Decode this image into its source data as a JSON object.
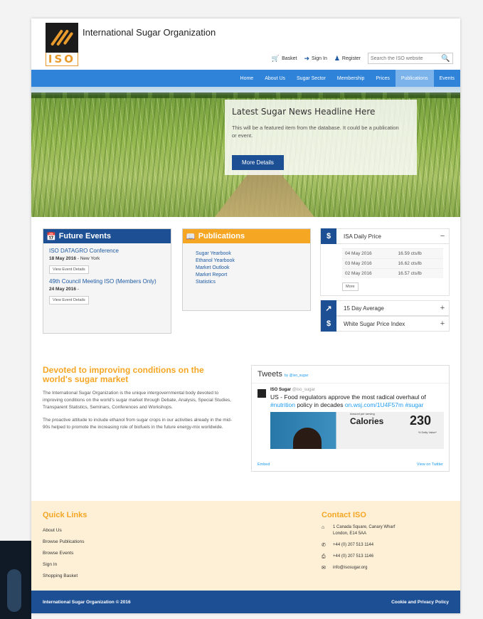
{
  "header": {
    "org_name": "International Sugar Organization",
    "logo_text": "ISO",
    "basket": "Basket",
    "sign_in": "Sign In",
    "register": "Register",
    "search_placeholder": "Search the ISO website"
  },
  "nav": {
    "items": [
      "Home",
      "About Us",
      "Sugar Sector",
      "Membership",
      "Prices",
      "Publications",
      "Events"
    ],
    "active": "Publications"
  },
  "hero": {
    "title": "Latest Sugar News Headline Here",
    "text": "This will be a featured item from the database. It could be a publication or event.",
    "button": "More Details"
  },
  "events": {
    "title": "Future Events",
    "items": [
      {
        "title": "ISO DATAGRO Conference",
        "date": "18 May 2016",
        "location": " - New York",
        "button": "View Event Details"
      },
      {
        "title": "49th Council Meeting ISO (Members Only)",
        "date": "24 May 2016",
        "location": " -",
        "button": "View Event Details"
      }
    ]
  },
  "publications": {
    "title": "Publications",
    "items": [
      "Sugar Yearbook",
      "Ethanol Yearbook",
      "Market Outlook",
      "Market Report",
      "Statistics"
    ]
  },
  "prices": {
    "isa": {
      "label": "ISA Daily Price",
      "toggle": "−"
    },
    "rows": [
      {
        "date": "04 May 2016",
        "value": "16.59 cts/lb"
      },
      {
        "date": "03 May 2016",
        "value": "16.62 cts/lb"
      },
      {
        "date": "02 May 2016",
        "value": "16.57 cts/lb"
      }
    ],
    "more": "More",
    "avg": {
      "label": "15 Day Average",
      "toggle": "+"
    },
    "white": {
      "label": "White Sugar Price Index",
      "toggle": "+"
    },
    "dollar_symbol": "$"
  },
  "about": {
    "heading": "Devoted to improving conditions on the world's sugar market",
    "para1": "The International Sugar Organization is the unique intergovernmental body devoted to improving conditions on the world's sugar market through Debate, Analysis, Special Studies, Transparent Statistics, Seminars, Conferences and Workshops.",
    "para2": "The proactive attitude to include ethanol from sugar crops in our activities already in the mid-90s helped to promote the increasing role of biofuels in the future energy-mix worldwide."
  },
  "tweets": {
    "title": "Tweets",
    "by": "by @iso_sugar",
    "user": "ISO Sugar",
    "handle": "@iso_sugar",
    "text_pre": "US - Food regulators approve the most radical overhaul of ",
    "hashtag1": "#nutrition",
    "text_mid": " policy in decades ",
    "link": "on.wsj.com/1U4F57m",
    "hashtag2": " #sugar",
    "img_calories": "Calories",
    "img_number": "230",
    "img_serving": "Amount per serving",
    "img_dv": "% Daily Value*",
    "embed": "Embed",
    "view": "View on Twitter"
  },
  "footer": {
    "quick_links_title": "Quick Links",
    "quick_links": [
      "About Us",
      "Browse Publications",
      "Browse Events",
      "Sign In",
      "Shopping Basket"
    ],
    "contact_title": "Contact ISO",
    "address1": "1 Canada Square, Canary Wharf",
    "address2": "London, E14 5AA",
    "phone": "+44 (0) 207 513 1144",
    "fax": "+44 (0) 207 513 1146",
    "email": "info@isosugar.org",
    "copyright": "International Sugar Organization © 2016",
    "policy": "Cookie and Privacy Policy"
  }
}
